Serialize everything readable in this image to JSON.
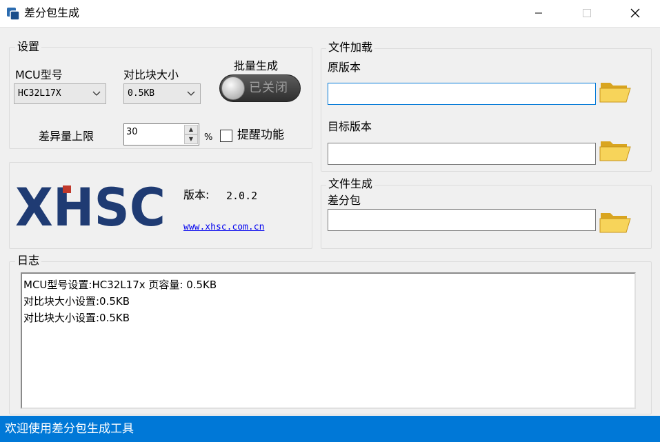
{
  "window": {
    "title": "差分包生成"
  },
  "settings": {
    "legend": "设置",
    "mcu_label": "MCU型号",
    "mcu_value": "HC32L17X",
    "block_label": "对比块大小",
    "block_value": "0.5KB",
    "batch_label": "批量生成",
    "batch_toggle_text": "已关闭",
    "diff_limit_label": "差异量上限",
    "diff_limit_value": "30",
    "percent_sign": "%",
    "remind_label": "提醒功能"
  },
  "about": {
    "logo_text": "XHSC",
    "version_label": "版本:",
    "version_value": "2.0.2",
    "website": "www.xhsc.com.cn",
    "brand_color": "#1f3b73",
    "brand_accent": "#c0392b"
  },
  "file_load": {
    "legend": "文件加载",
    "original_label": "原版本",
    "original_value": "",
    "target_label": "目标版本",
    "target_value": ""
  },
  "file_gen": {
    "legend": "文件生成",
    "diff_label": "差分包",
    "diff_value": ""
  },
  "log": {
    "legend": "日志",
    "lines": [
      "MCU型号设置:HC32L17x 页容量: 0.5KB",
      "对比块大小设置:0.5KB",
      "对比块大小设置:0.5KB"
    ]
  },
  "status": {
    "text": "欢迎使用差分包生成工具"
  }
}
